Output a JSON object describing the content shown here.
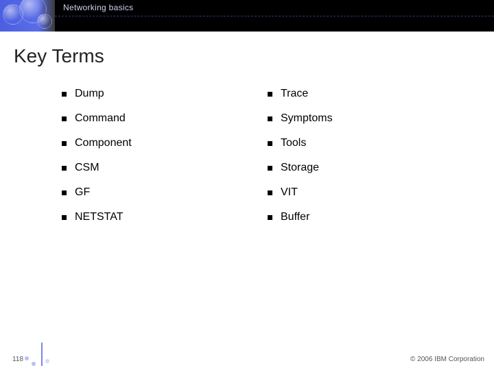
{
  "header": {
    "section_label": "Networking basics"
  },
  "title": "Key Terms",
  "terms_left": [
    "Dump",
    "Command",
    "Component",
    "CSM",
    "GF",
    "NETSTAT"
  ],
  "terms_right": [
    "Trace",
    "Symptoms",
    "Tools",
    "Storage",
    "VIT",
    "Buffer"
  ],
  "footer": {
    "page_number": "118",
    "copyright": "© 2006 IBM Corporation"
  }
}
